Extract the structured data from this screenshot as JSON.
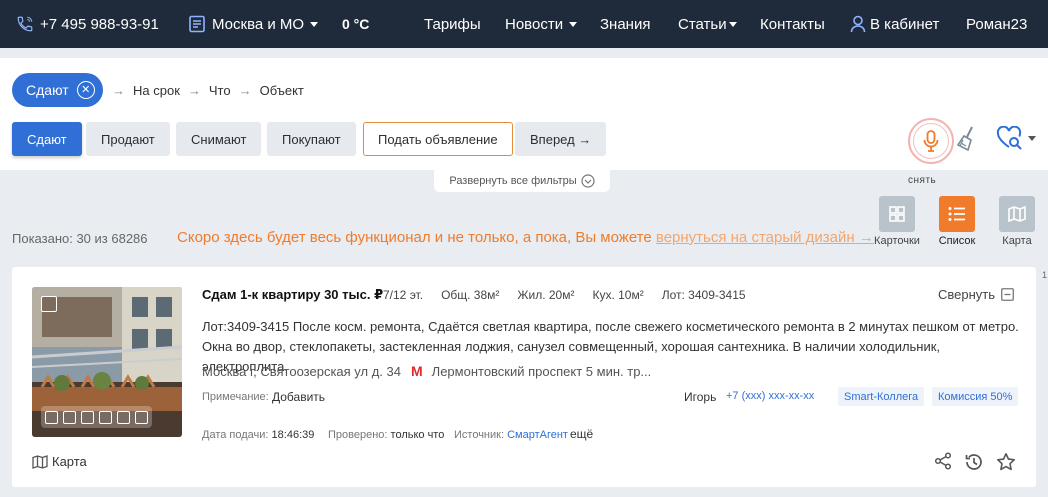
{
  "nav": {
    "phone": "+7 495 988-93-91",
    "region": "Москва и МО",
    "temperature": "0 °C",
    "tariffs": "Тарифы",
    "news": "Новости",
    "knowledge": "Знания",
    "articles": "Статьи",
    "contacts": "Контакты",
    "cabinet": "В кабинет",
    "user": "Роман23"
  },
  "search": {
    "chip": "Сдают",
    "crumbs": [
      "На срок",
      "Что",
      "Объект"
    ],
    "arrow": "→",
    "buttons": {
      "rent": "Сдают",
      "sell": "Продают",
      "lease": "Снимают",
      "buy": "Покупают",
      "post": "Подать объявление",
      "next": "Вперед →"
    },
    "expand": "Развернуть все фильтры",
    "voice_label": "снять"
  },
  "views": {
    "cards": "Карточки",
    "list": "Список",
    "map": "Карта"
  },
  "results": {
    "shown": "Показано: 30 из 68286",
    "notice_text": "Скоро здесь будет весь функционал и не только, а пока, Вы можете",
    "notice_link": "вернуться на старый дизайн →",
    "scroll_marker": "1"
  },
  "listing": {
    "title": "Сдам 1-к квартиру 30 тыс. ₽",
    "floor": "7/12 эт.",
    "total_area": "Общ. 38м²",
    "living_area": "Жил. 20м²",
    "kitchen_area": "Кух. 10м²",
    "lot": "Лот: 3409-3415",
    "collapse": "Свернуть",
    "description": "Лот:3409-3415 После косм. ремонта, Сдаётся светлая квартира, после свежего косметического ремонта в 2 минутах пешком от метро. Окна во двор, стеклопакеты, застекленная лоджия, санузел совмещенный, хорошая сантехника. В наличии холодильник, электроплита,",
    "address": "Москва г, Святоозерская ул д. 34",
    "metro_letter": "М",
    "metro": "Лермонтовский проспект 5 мин. тр...",
    "note_label": "Примечание:",
    "note_add": "Добавить",
    "agent": "Игорь",
    "phone": "+7 (xxx) xxx-xx-xx",
    "company": "Smart-Коллега",
    "fee": "Комиссия 50%",
    "date_label": "Дата подачи:",
    "date": "18:46:39",
    "checked_label": "Проверено:",
    "checked": "только что",
    "source_label": "Источник:",
    "source": "СмартАгент",
    "more": "ещё",
    "map": "Карта"
  },
  "colors": {
    "nav_bg": "#1f2b3a",
    "primary": "#2f6fd6",
    "accent": "#f07b2b",
    "metro": "#e32b2b"
  }
}
